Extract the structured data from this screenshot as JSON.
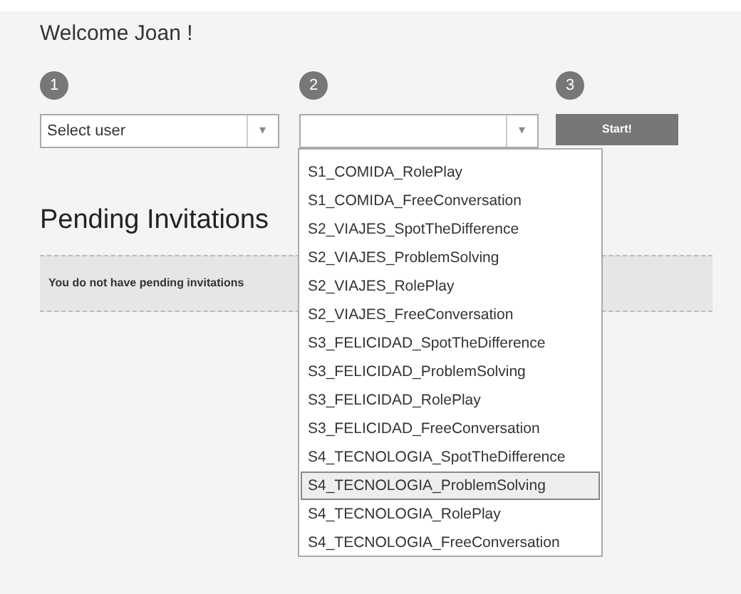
{
  "welcome": "Welcome Joan !",
  "steps": [
    "1",
    "2",
    "3"
  ],
  "user_select": {
    "placeholder": "Select user",
    "arrow": "▾"
  },
  "activity_select": {
    "arrow": "▾",
    "options": [
      {
        "label": "S1_COMIDA_RolePlay",
        "selected": false
      },
      {
        "label": "S1_COMIDA_FreeConversation",
        "selected": false
      },
      {
        "label": "S2_VIAJES_SpotTheDifference",
        "selected": false
      },
      {
        "label": "S2_VIAJES_ProblemSolving",
        "selected": false
      },
      {
        "label": "S2_VIAJES_RolePlay",
        "selected": false
      },
      {
        "label": "S2_VIAJES_FreeConversation",
        "selected": false
      },
      {
        "label": "S3_FELICIDAD_SpotTheDifference",
        "selected": false
      },
      {
        "label": "S3_FELICIDAD_ProblemSolving",
        "selected": false
      },
      {
        "label": "S3_FELICIDAD_RolePlay",
        "selected": false
      },
      {
        "label": "S3_FELICIDAD_FreeConversation",
        "selected": false
      },
      {
        "label": "S4_TECNOLOGIA_SpotTheDifference",
        "selected": false
      },
      {
        "label": "S4_TECNOLOGIA_ProblemSolving",
        "selected": true
      },
      {
        "label": "S4_TECNOLOGIA_RolePlay",
        "selected": false
      },
      {
        "label": "S4_TECNOLOGIA_FreeConversation",
        "selected": false
      }
    ]
  },
  "start_button": "Start!",
  "pending": {
    "title": "Pending Invitations",
    "message": "You do not have pending invitations"
  }
}
